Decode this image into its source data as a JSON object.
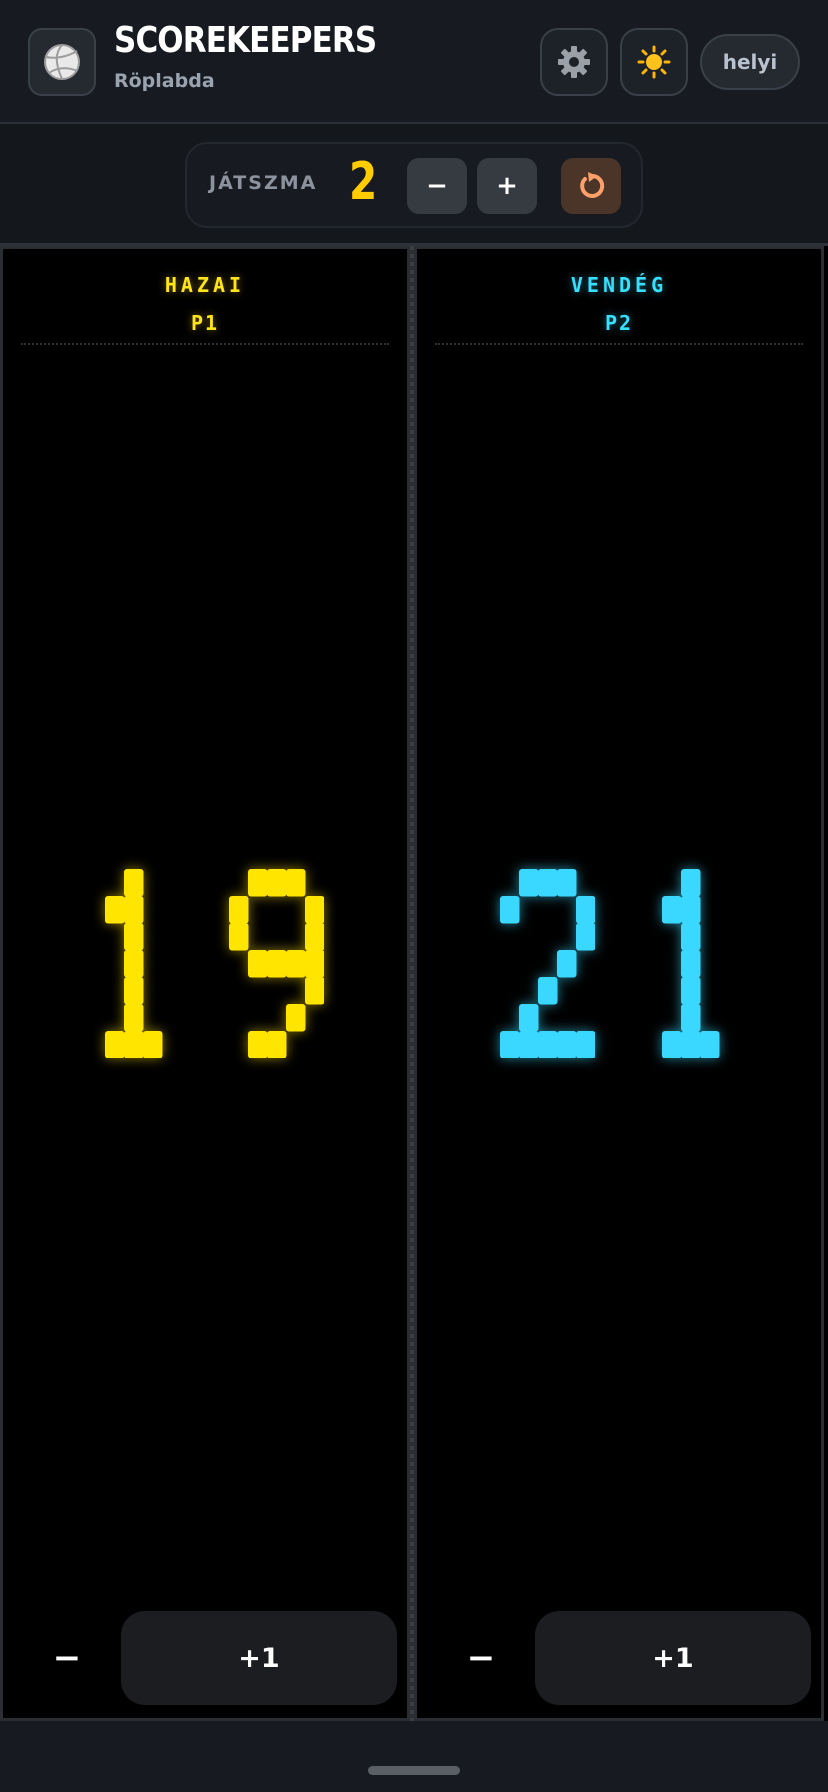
{
  "header": {
    "app_icon": "volleyball-icon",
    "title": "SCOREKEEPERS",
    "subtitle": "Röplabda",
    "settings_icon": "gear-icon",
    "theme_icon": "sun-icon",
    "mode_label": "helyi"
  },
  "set_bar": {
    "label": "JÁTSZMA",
    "value": "2",
    "minus_label": "−",
    "plus_label": "+",
    "reset_icon": "reset-icon"
  },
  "teams": [
    {
      "team": "HAZAI",
      "player": "P1",
      "score": "19",
      "color": "#ffe500",
      "minus_label": "−",
      "plus_label": "+1"
    },
    {
      "team": "VENDÉG",
      "player": "P2",
      "score": "21",
      "color": "#3ad8ff",
      "minus_label": "−",
      "plus_label": "+1"
    }
  ]
}
